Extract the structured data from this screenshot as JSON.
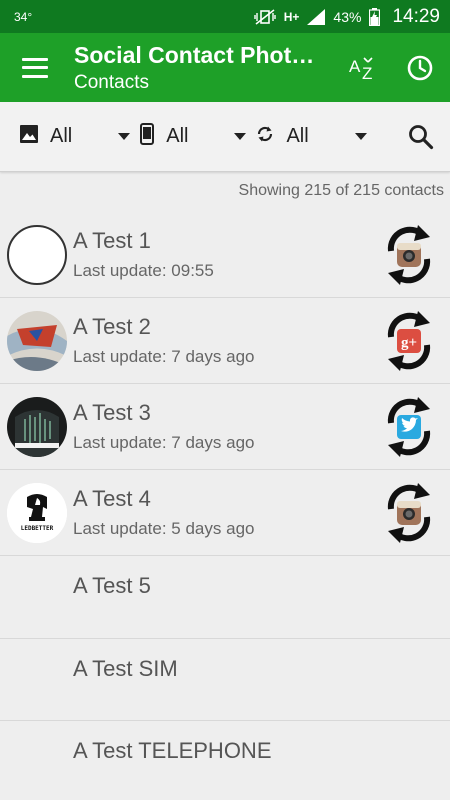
{
  "status_bar": {
    "left": "34°",
    "network": "H+",
    "battery": "43%",
    "time": "14:29"
  },
  "app_bar": {
    "title": "Social Contact Phot…",
    "subtitle": "Contacts",
    "sort_icon": "az-sort-icon",
    "history_icon": "clock-icon"
  },
  "filters": [
    {
      "icon": "image-icon",
      "label": "All"
    },
    {
      "icon": "phone-icon",
      "label": "All"
    },
    {
      "icon": "sync-icon",
      "label": "All"
    }
  ],
  "count_text": "Showing 215 of 215 contacts",
  "contacts": [
    {
      "name": "A Test 1",
      "last_update": "Last update: 09:55",
      "avatar": "blank",
      "source": "instagram"
    },
    {
      "name": "A Test 2",
      "last_update": "Last update: 7 days ago",
      "avatar": "photo-superman",
      "source": "google-plus"
    },
    {
      "name": "A Test 3",
      "last_update": "Last update: 7 days ago",
      "avatar": "photo-dark",
      "source": "twitter"
    },
    {
      "name": "A Test 4",
      "last_update": "Last update: 5 days ago",
      "avatar": "logo-ledbetter",
      "avatar_text": "LEDBETTER",
      "source": "instagram"
    },
    {
      "name": "A Test 5"
    },
    {
      "name": "A Test SIM"
    },
    {
      "name": "A Test TELEPHONE"
    }
  ],
  "colors": {
    "status_bar": "#0f7a20",
    "app_bar": "#1ea028",
    "google_plus": "#dc4e41",
    "twitter": "#2aa9e0",
    "instagram": "#a0745a"
  }
}
